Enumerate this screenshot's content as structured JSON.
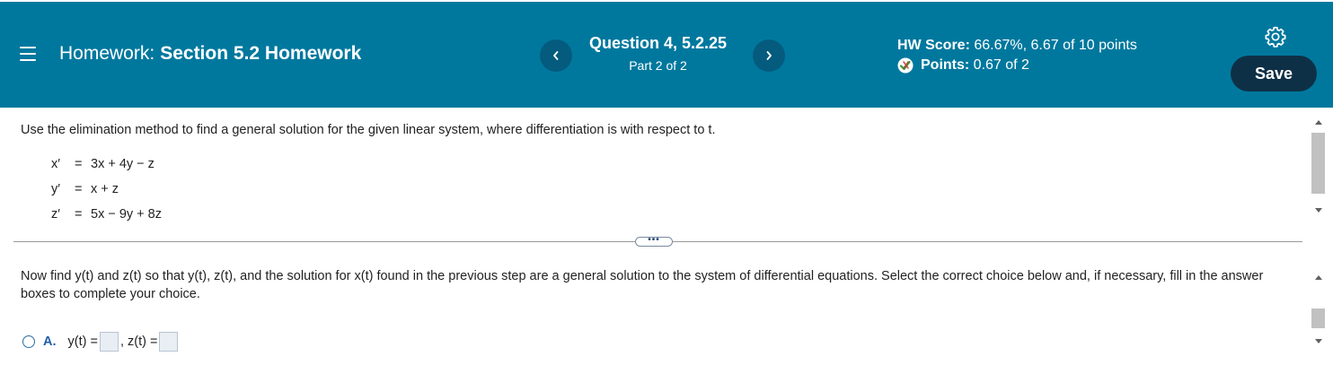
{
  "header": {
    "homework_prefix": "Homework:",
    "homework_name": "Section 5.2 Homework",
    "prev_label": "‹",
    "next_label": "›",
    "question_title": "Question 4, 5.2.25",
    "question_part": "Part 2 of 2",
    "hw_score_label": "HW Score:",
    "hw_score_value": "66.67%, 6.67 of 10 points",
    "points_label": "Points:",
    "points_value": "0.67 of 2",
    "save_label": "Save",
    "colors": {
      "bar": "#00789e",
      "nav": "#045b7e",
      "save": "#0e3046"
    }
  },
  "question": {
    "prompt": "Use the elimination method to find a general solution for the given linear system, where differentiation is with respect to t.",
    "equations": [
      {
        "lhs": "x′",
        "eq": "=",
        "rhs": "3x + 4y − z"
      },
      {
        "lhs": "y′",
        "eq": "=",
        "rhs": "x + z"
      },
      {
        "lhs": "z′",
        "eq": "=",
        "rhs": "5x − 9y + 8z"
      }
    ],
    "instructions": "Now find y(t) and z(t) so that y(t), z(t), and the solution for x(t) found in the previous step are a general solution to the system of differential equations. Select the correct choice below and, if necessary, fill in the answer boxes to complete your choice.",
    "choice_a": {
      "letter": "A.",
      "y_label": "y(t) =",
      "z_label": "z(t) =",
      "separator": ","
    }
  },
  "icons": {
    "menu": "hamburger-menu-icon",
    "points": "partial-credit-icon",
    "settings": "gear-icon",
    "more": "ellipsis-icon"
  }
}
